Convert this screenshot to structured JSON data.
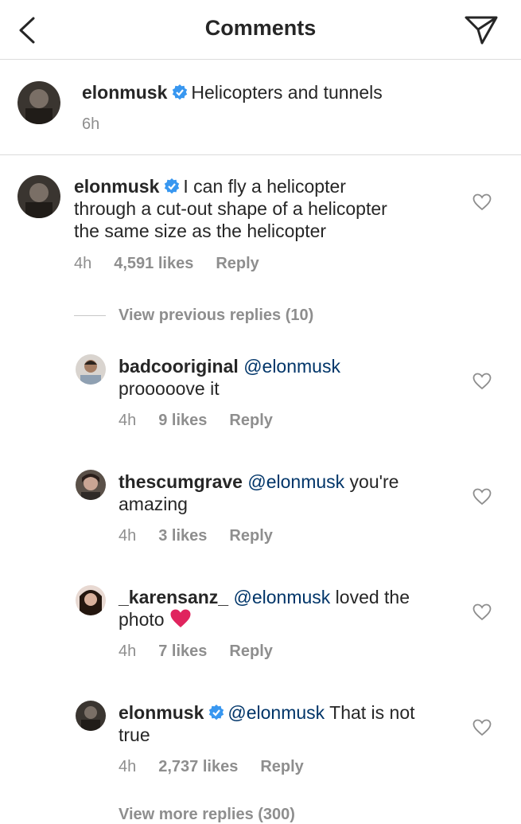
{
  "header": {
    "title": "Comments"
  },
  "caption": {
    "username": "elonmusk",
    "text": "Helicopters and tunnels",
    "time": "6h"
  },
  "comments": [
    {
      "username": "elonmusk",
      "verified": true,
      "lines": [
        "I can fly a helicopter",
        "through a cut-out shape of a helicopter",
        "the same size as the helicopter"
      ],
      "time": "4h",
      "likes": "4,591 likes",
      "reply": "Reply"
    }
  ],
  "view_previous": "View previous replies (10)",
  "replies": [
    {
      "username": "badcooriginal",
      "mention": "@elonmusk",
      "text_after": "",
      "line2": "prooooove it",
      "time": "4h",
      "likes": "9 likes",
      "reply": "Reply"
    },
    {
      "username": "thescumgrave",
      "mention": "@elonmusk",
      "text_after": " you're",
      "line2": "amazing",
      "time": "4h",
      "likes": "3 likes",
      "reply": "Reply"
    },
    {
      "username": "_karensanz_",
      "mention": "@elonmusk",
      "text_after": " loved the",
      "line2": "photo",
      "time": "4h",
      "likes": "7 likes",
      "reply": "Reply"
    },
    {
      "username": "elonmusk",
      "verified": true,
      "mention": "@elonmusk",
      "text_after": " That is not",
      "line2": "true",
      "time": "4h",
      "likes": "2,737 likes",
      "reply": "Reply"
    }
  ],
  "view_more": "View more replies (300)",
  "colors": {
    "mention": "#003569",
    "meta": "#8e8e8e",
    "verified": "#3897f0",
    "heart_emoji": "#e0245e"
  }
}
